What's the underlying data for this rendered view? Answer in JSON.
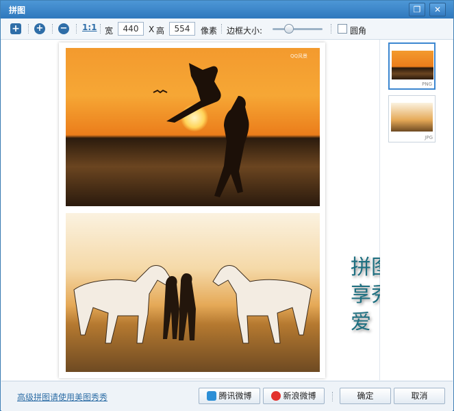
{
  "window": {
    "title": "拼图",
    "restore_icon": "restore-icon",
    "close_icon": "close-icon"
  },
  "toolbar": {
    "add_icon": "plus-icon",
    "zoom_in_icon": "zoom-in-icon",
    "zoom_out_icon": "zoom-out-icon",
    "actual_size_label": "1:1",
    "width_label": "宽",
    "width_value": "440",
    "x_label": "X",
    "height_label": "高",
    "height_value": "554",
    "unit_label": "像素",
    "border_label": "边框大小:",
    "border_level": 0.35,
    "rounded_label": "圆角",
    "rounded_checked": false
  },
  "canvas": {
    "watermark": "QQ风景",
    "overlay_lines": [
      "拼图分",
      "享秀恩",
      "爱"
    ]
  },
  "thumbnails": [
    {
      "ext": "PNG",
      "selected": true
    },
    {
      "ext": "JPG",
      "selected": false
    }
  ],
  "footer": {
    "advanced_link": "高级拼图请使用美图秀秀",
    "tencent_button": "腾讯微博",
    "sina_button": "新浪微博",
    "ok_button": "确定",
    "cancel_button": "取消"
  },
  "colors": {
    "title_bar": "#3a86cc",
    "accent": "#2f6ea8",
    "overlay_text": "#1d6f80"
  }
}
